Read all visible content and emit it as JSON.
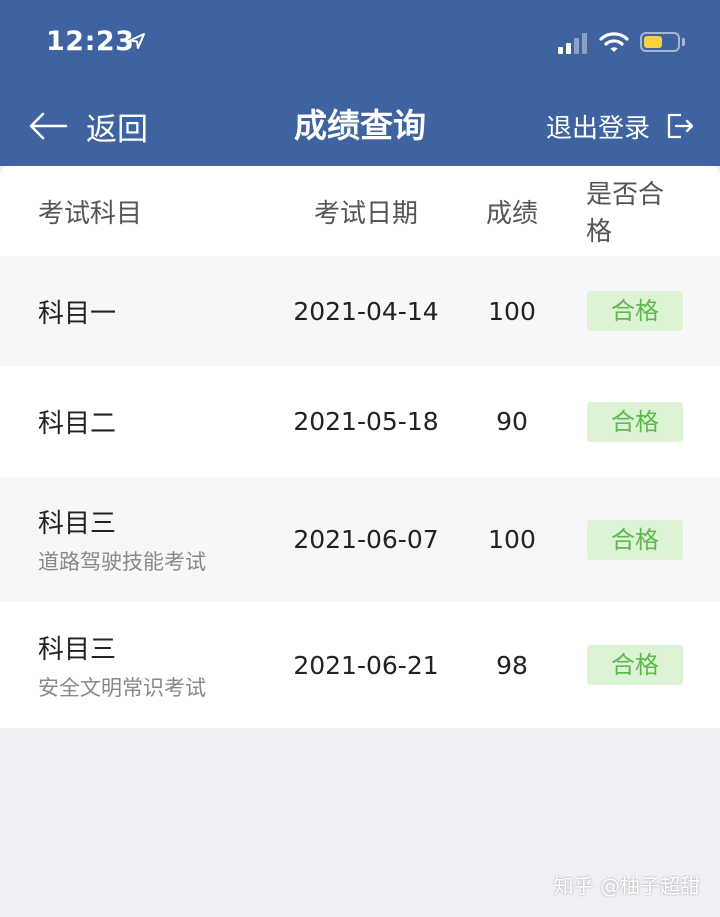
{
  "status_bar": {
    "time": "12:23",
    "battery_level": 0.55,
    "signal_bars": 4,
    "signal_active_bars": 2
  },
  "nav": {
    "back_label": "返回",
    "title": "成绩查询",
    "logout_label": "退出登录"
  },
  "table": {
    "headers": {
      "subject": "考试科目",
      "date": "考试日期",
      "score": "成绩",
      "pass": "是否合格"
    },
    "rows": [
      {
        "subject": "科目一",
        "subtitle": "",
        "date": "2021-04-14",
        "score": "100",
        "pass": "合格"
      },
      {
        "subject": "科目二",
        "subtitle": "",
        "date": "2021-05-18",
        "score": "90",
        "pass": "合格"
      },
      {
        "subject": "科目三",
        "subtitle": "道路驾驶技能考试",
        "date": "2021-06-07",
        "score": "100",
        "pass": "合格"
      },
      {
        "subject": "科目三",
        "subtitle": "安全文明常识考试",
        "date": "2021-06-21",
        "score": "98",
        "pass": "合格"
      }
    ]
  },
  "watermark": "知乎 @柚子超甜",
  "colors": {
    "header_bg": "#3f63a0",
    "pass_badge_bg": "#ddf3d6",
    "pass_badge_text": "#5fb84f",
    "page_bg": "#efeff4",
    "battery": "#f5d33a"
  },
  "icons": [
    "location-arrow-icon",
    "signal-icon",
    "wifi-icon",
    "battery-icon",
    "back-arrow-icon",
    "logout-icon"
  ]
}
